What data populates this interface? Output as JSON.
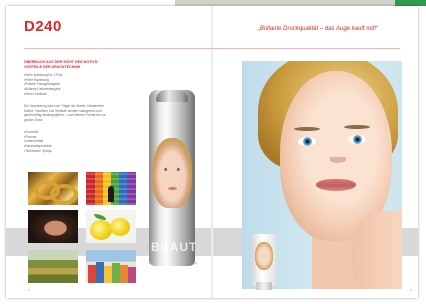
{
  "document": {
    "title": "D240",
    "tagline": "„Brillante Druckqualität – das Auge kauft mit!“"
  },
  "left_page": {
    "section_heading": "Überblick aus der Sicht des Motivs: Vorteile der Drucktechnik",
    "list_a": [
      "Hohe Auflösung bis 175 lpi",
      "Feine Rasterung",
      "Präzise Passgenauigkeit",
      "Brillante Farbwiedergabe",
      "Hoher Kontrast"
    ],
    "paragraph": "Die Verpackung wird zum Träger der Marke. Detailreiche Motive, Hauttöne und Verläufe werden naturgetreu und gleichmäßig wiedergegeben – vom kleinen Format bis zur großen Dose.",
    "list_b": [
      "Kosmetik",
      "Pharma",
      "Lebensmittel",
      "Haushaltsprodukte",
      "Technische Sprays"
    ],
    "page_number": "2",
    "can": {
      "logo_text": "",
      "big_word": "BEAUT"
    }
  },
  "right_page": {
    "tube_label": "",
    "page_number": "3"
  },
  "colors": {
    "accent": "#e3262c",
    "band": "#d8d8d8",
    "top_bar_green": "#2f9b52"
  }
}
